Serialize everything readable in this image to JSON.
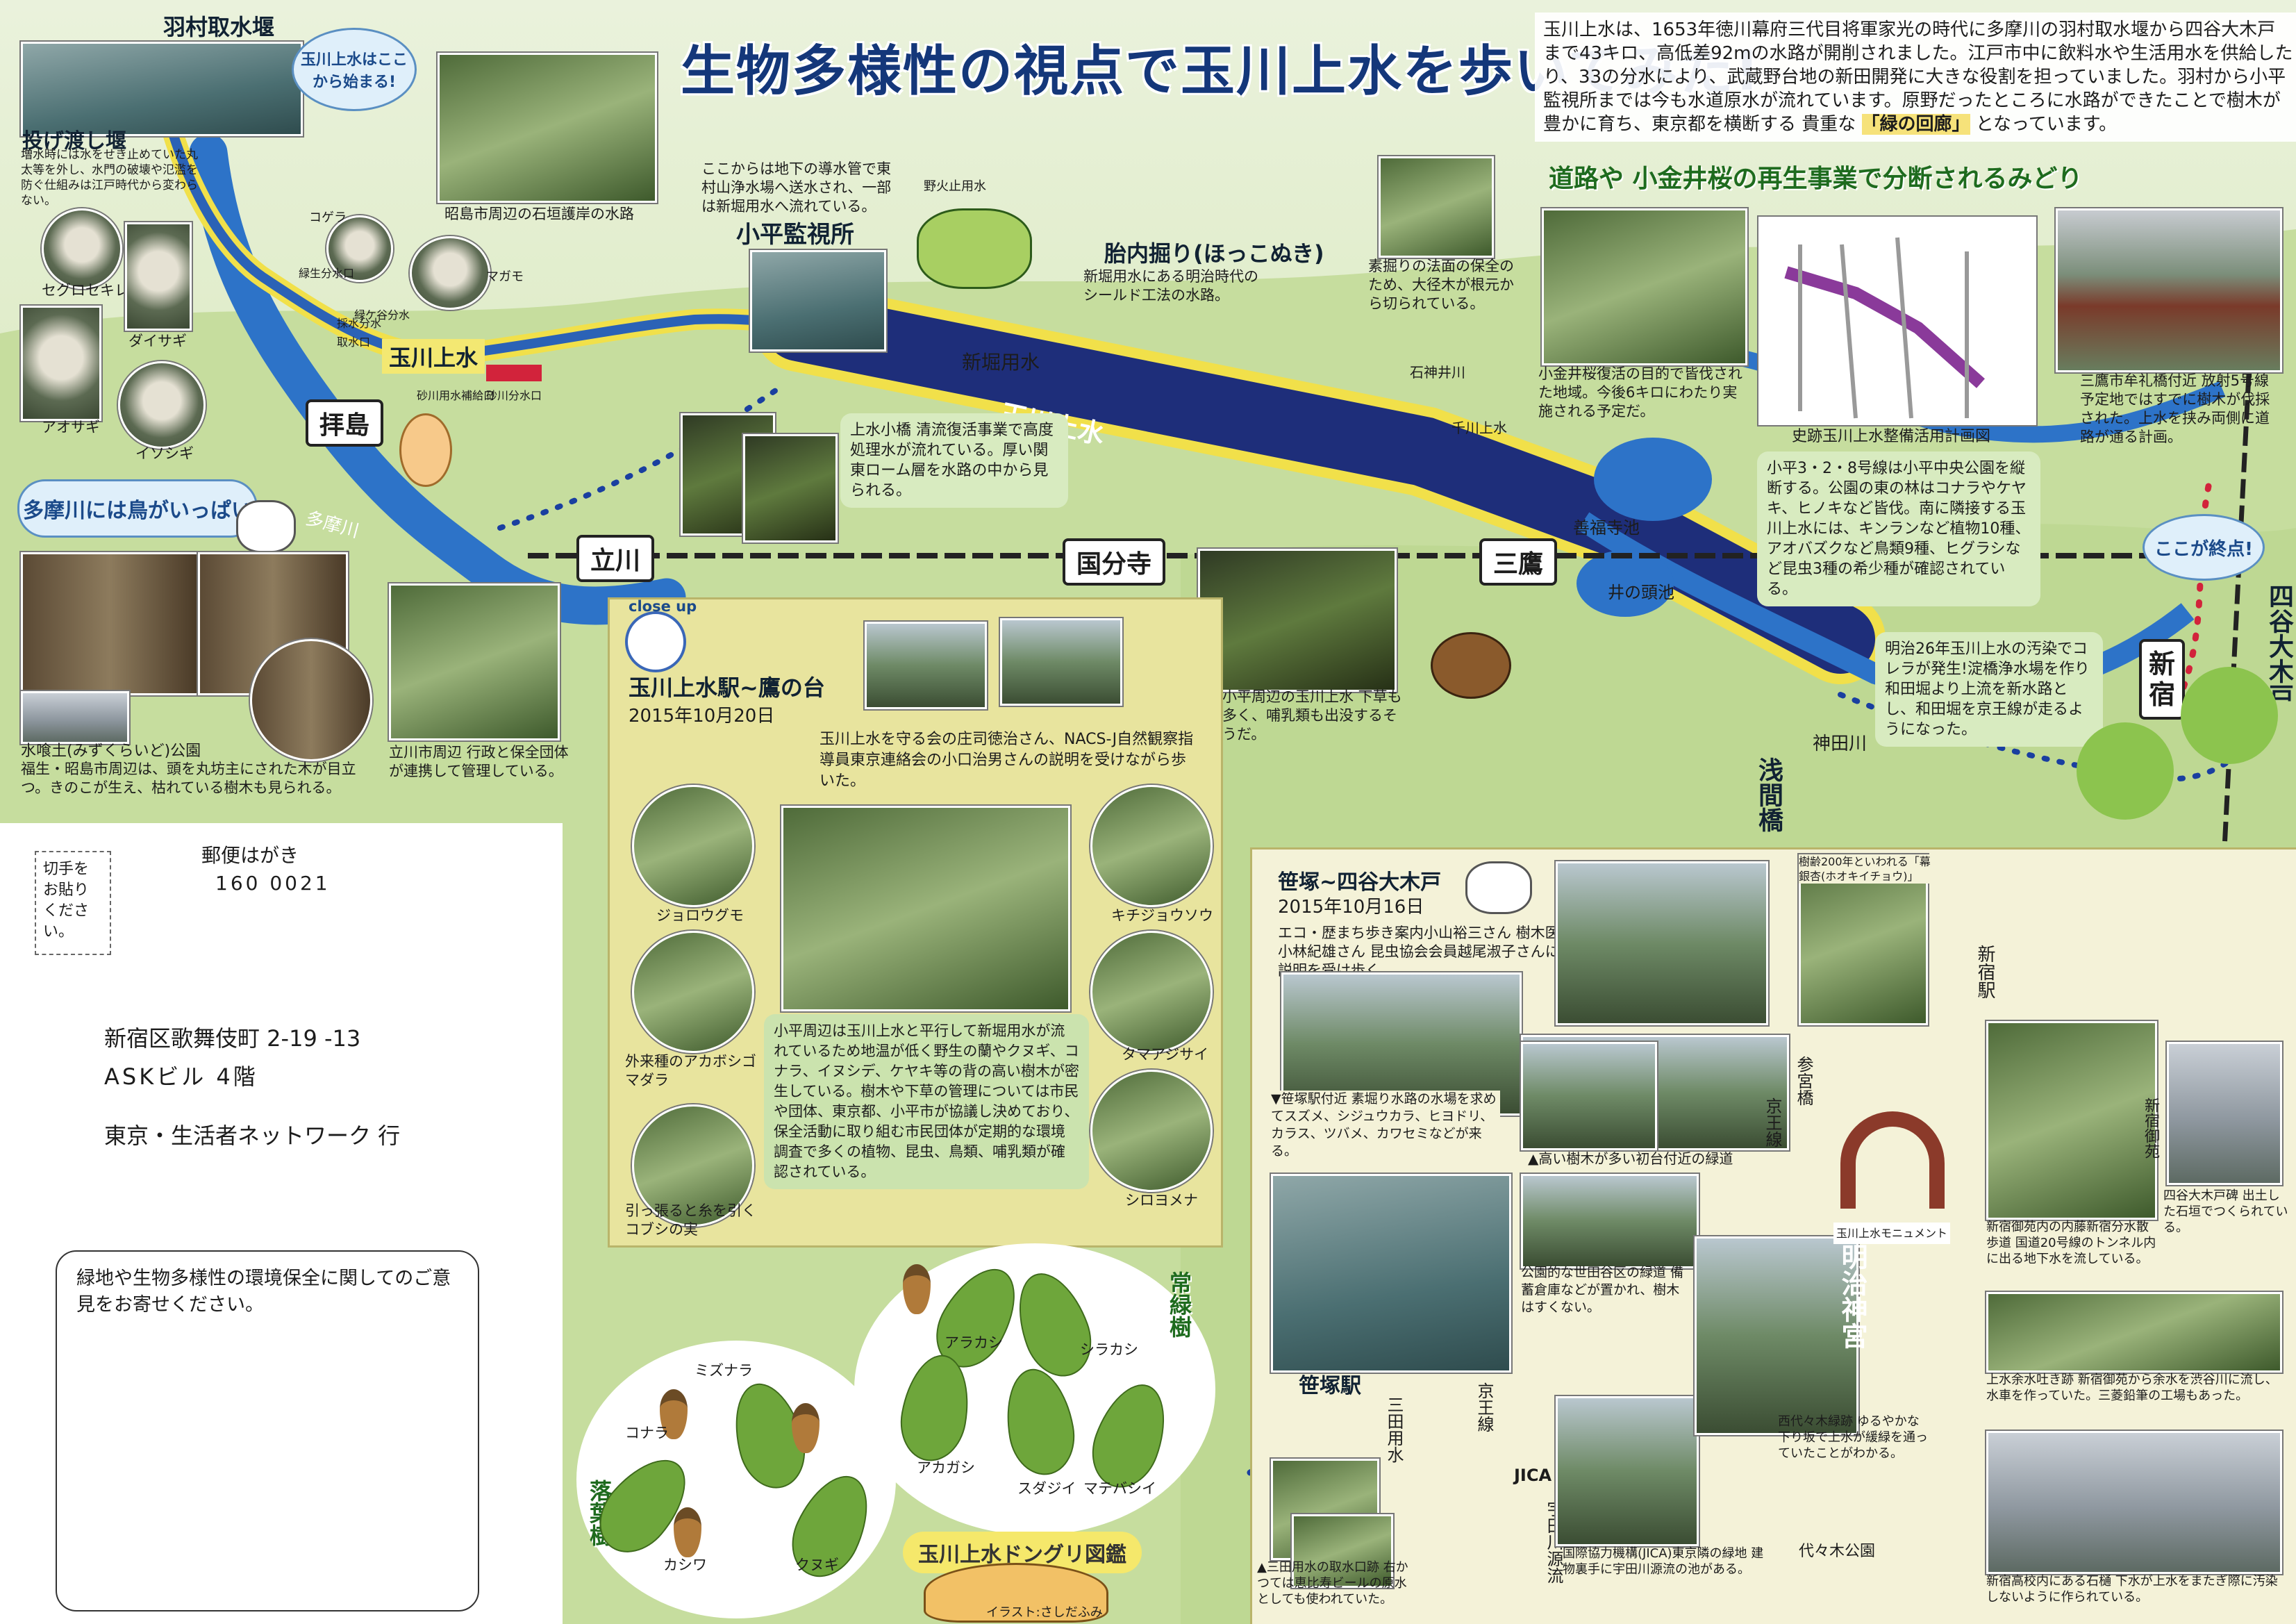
{
  "title": "生物多様性の視点で玉川上水を歩いてみた!",
  "intro": {
    "text": "玉川上水は、1653年徳川幕府三代目将軍家光の時代に多摩川の羽村取水堰から四谷大木戸まで43キロ、高低差92mの水路が開削されました。江戸市中に飲料水や生活用水を供給したり、33の分水により、武蔵野台地の新田開発に大きな役割を担っていました。羽村から小平監視所までは今も水道原水が流れています。原野だったところに水路ができたことで樹木が豊かに育ち、東京都を横断する 貴重な",
    "highlight": "「緑の回廊」",
    "tail": "となっています。"
  },
  "colors": {
    "river": "#2d73c8",
    "canal": "#1e2e7a",
    "canal_edge": "#f1e04a",
    "path": "#f3e872",
    "rail": "#222222",
    "dots": "#1a3fa0",
    "red_dots": "#d2233b"
  },
  "stations": {
    "haijima": "拝島",
    "tachikawa": "立川",
    "kokubunji": "国分寺",
    "mitaka": "三鷹",
    "shinjuku": "新宿",
    "yotsuya": "四谷大木戸",
    "sasazuka": "笹塚駅"
  },
  "map_labels": {
    "hamura": "羽村取水堰",
    "nagewatashi": "投げ渡し堰",
    "nagewatashi_note": "増水時には水をせき止めていた丸太等を外し、水門の破壊や氾濫を防ぐ仕組みは江戸時代から変わらない。",
    "start_bubble": "玉川上水はここから始まる!",
    "showa": "昭島市周辺の石垣護岸の水路",
    "kodaira_note": "ここからは地下の導水管で東村山浄水場へ送水され、一部は新堀用水へ流れている。",
    "kodaira": "小平監視所",
    "tainai": "胎内掘り(ほっこぬき)",
    "tainai_note": "新堀用水にある明治時代のシールド工法の水路。",
    "tamagawa_josui": "玉川上水",
    "tamagawa_josui_canal": "玉川上水",
    "tamagawa_river": "多摩川",
    "tamagawa_birds": "多摩川には鳥がいっぱい",
    "shinbori": "新堀用水",
    "nobidome": "野火止用水",
    "senkawa": "千川上水",
    "kanda": "神田川",
    "zenpukuji": "善福寺池",
    "inokashira": "井の頭池",
    "asama": "浅間橋",
    "shakuji": "石神井川",
    "end_bubble": "ここが終点!",
    "birds": [
      "セグロセキレイ",
      "ダイサギ",
      "アオサギ",
      "イソシギ",
      "コゲラ",
      "マガモ"
    ],
    "birds_extra": [
      "緑ケ谷分水",
      "緑生分水口",
      "採水分水取水口",
      "砂川用水補給口",
      "砂川分水口"
    ],
    "mizukui": "水喰土(みずくらいど)公園",
    "mizukui_note": "福生・昭島市周辺は、頭を丸坊主にされた木が目立つ。きのこが生え、枯れている樹木も見られる。",
    "tachikawa_note": "立川市周辺 行政と保全団体が連携して管理している。",
    "jouwa_note": "上水小橋 清流復活事業で高度処理水が流れている。厚い関東ローム層を水路の中から見られる。",
    "kodaira_dark_note": "小平周辺の玉川上水 下草も多く、哺乳類も出没するそうだ。",
    "sukibori_note": "素掘りの法面の保全のため、大径木が根元から切られている。",
    "koganei_note": "小金井桜復活の目的で皆伐された地域。今後6キロにわたり実施される予定だ。",
    "mitaka_note": "三鷹市牟礼橋付近 放射5号線予定地ではすでに樹木が伐採された。上水を挟み両側に道路が通る計画。",
    "kodaira328_note": "小平3・2・8号線は小平中央公園を縦断する。公園の東の林はコナラやケヤキ、ヒノキなど皆伐。南に隣接する玉川上水には、キンランなど植物10種、アオバズクなど鳥類9種、ヒグラシなど昆虫3種の希少種が確認されている。",
    "meiji_note": "明治26年玉川上水の汚染でコレラが発生!淀橋浄水場を作り和田堀より上流を新水路とし、和田堀を京王線が走るようになった。",
    "plan_caption": "史跡玉川上水整備活用計画図",
    "green_heading": "道路や 小金井桜の再生事業で分断されるみどり"
  },
  "panel1": {
    "title": "玉川上水駅~鷹の台",
    "date": "2015年10月20日",
    "intro": "玉川上水を守る会の庄司徳治さん、NACS-J自然観察指導員東京連絡会の小口治男さんの説明を受けながら歩いた。",
    "body": "小平周辺は玉川上水と平行して新堀用水が流れているため地温が低く野生の蘭やクヌギ、コナラ、イヌシデ、ケヤキ等の背の高い樹木が密生している。樹木や下草の管理については市民や団体、東京都、小平市が協議し決めており、保全活動に取り組む市民団体が定期的な環境調査で多くの植物、昆虫、鳥類、哺乳類が確認されている。",
    "species": [
      "ジョロウグモ",
      "外来種のアカボシゴマダラ",
      "引っ張ると糸を引くコブシの実",
      "キチジョウソウ",
      "タマアジサイ",
      "シロヨメナ"
    ],
    "close_up": "close up"
  },
  "panel2": {
    "title": "笹塚~四谷大木戸",
    "date": "2015年10月16日",
    "intro": "エコ・歴まち歩き案内小山裕三さん 樹木医小林紀雄さん 昆虫協会会員越尾淑子さんに説明を受け歩く。",
    "caption_a": "▲高い樹木が多い初台付近の緑道",
    "caption_b": "▼笹塚駅付近 素堀り水路の水場を求めてスズメ、シジュウカラ、ヒヨドリ、カラス、ツバメ、カワセミなどが来る。",
    "caption_c": "公園的な世田谷区の緑道 備蓄倉庫などが置かれ、樹木はすくない。",
    "caption_d": "▲三田用水の取水口跡 右かつては恵比寿ビールの原水としても使われていた。",
    "caption_e": "国際協力機構(JICA)東京隣の緑地 建物裏手に宇田川源流の池がある。",
    "caption_f": "西代々木緑跡 ゆるやかな下り坂で上水が緩緑を通っていたことがわかる。",
    "ginkgo": "樹齢200年といわれる「幕銀杏(ホオキイチョウ)」",
    "monument": "玉川上水モニュメント",
    "shinjuku_note": "新宿御苑内の内藤新宿分水散歩道 国道20号線のトンネル内に出る地下水を流している。",
    "yotsuya_note": "四谷大木戸碑 出土した石垣でつくられている。",
    "yosui_note": "上水余水吐き跡 新宿御苑から余水を渋谷川に流し、水車を作っていた。三菱鉛筆の工場もあった。",
    "school_note": "新宿高校内にある石樋 下水が上水をまたぎ際に汚染しないように作られている。",
    "meiji_jingu": "明治神宮",
    "yoyogi": "代々木公園",
    "keio": "京王線",
    "udagawa": "宇田川源流",
    "mita": "三田用水",
    "jica": "JICA",
    "shinjuku_gyoen": "新宿御苑",
    "shinjuku_st": "新宿駅",
    "sangubashi": "参宮橋"
  },
  "acorns": {
    "title": "玉川上水ドングリ図鑑",
    "evergreen": "常緑樹",
    "deciduous": "落葉樹",
    "names": [
      "ミズナラ",
      "コナラ",
      "カシワ",
      "クヌギ",
      "アラカシ",
      "シラカシ",
      "アカガシ",
      "スダジイ",
      "マテバシイ"
    ],
    "illustrator": "イラスト:さしだふみ"
  },
  "postcard": {
    "stamp": "切手をお貼りください。",
    "label": "郵便はがき",
    "zip": "160 0021",
    "address1": "新宿区歌舞伎町 2-19 -13",
    "address2": "ASKビル 4階",
    "recipient": "東京・生活者ネットワーク 行",
    "comment": "緑地や生物多様性の環境保全に関してのご意見をお寄せください。"
  }
}
